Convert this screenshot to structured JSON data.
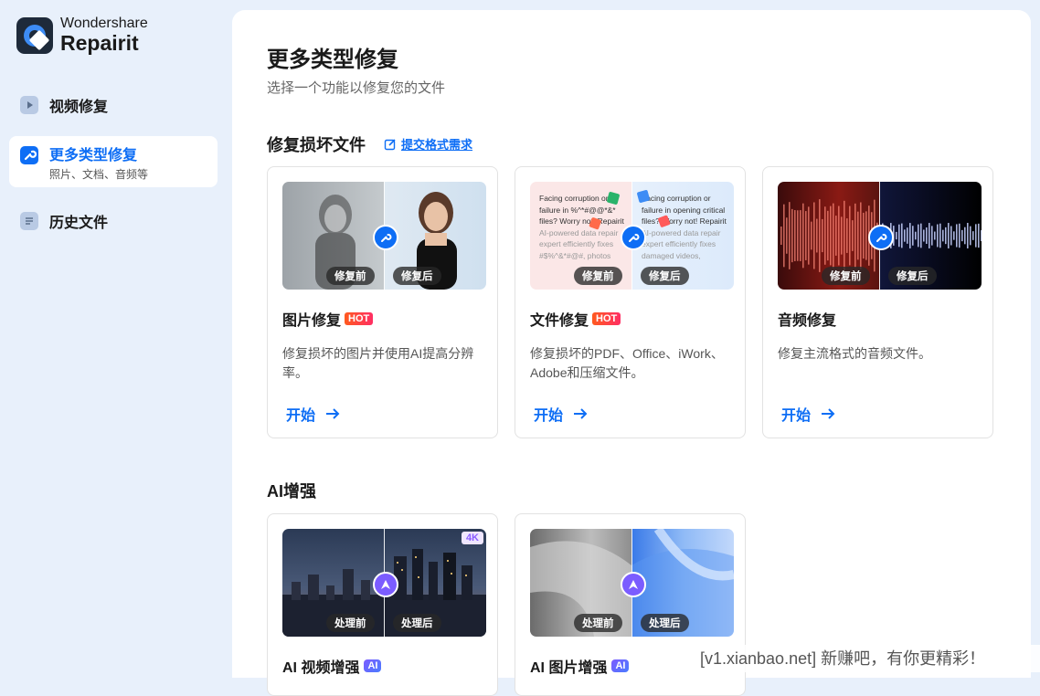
{
  "app": {
    "brand_line1": "Wondershare",
    "brand_line2": "Repairit"
  },
  "sidebar": {
    "items": [
      {
        "label": "视频修复",
        "icon": "play-icon"
      },
      {
        "label": "更多类型修复",
        "sub": "照片、文档、音频等",
        "icon": "wrench-icon"
      },
      {
        "label": "历史文件",
        "icon": "list-icon"
      }
    ]
  },
  "main": {
    "title": "更多类型修复",
    "subtitle": "选择一个功能以修复您的文件",
    "section1": {
      "title": "修复损坏文件",
      "link": "提交格式需求",
      "cards": [
        {
          "title": "图片修复",
          "badge": "HOT",
          "desc": "修复损坏的图片并使用AI提高分辨率。",
          "start": "开始",
          "before": "修复前",
          "after": "修复后"
        },
        {
          "title": "文件修复",
          "badge": "HOT",
          "desc": "修复损坏的PDF、Office、iWork、Adobe和压缩文件。",
          "start": "开始",
          "before": "修复前",
          "after": "修复后",
          "doc_text": [
            "Facing corruption or",
            "failure in %^*#@@*&*",
            "files? Worry not! Repairit",
            "AI-powered data repair",
            "expert efficiently fixes",
            "#$%^&*#@#, photos"
          ],
          "doc_text_right": [
            "Facing corruption or",
            "failure in opening critical",
            "files? Worry not! Repairit",
            "AI-powered data repair",
            "expert efficiently fixes",
            "damaged videos,"
          ]
        },
        {
          "title": "音频修复",
          "badge": "",
          "desc": "修复主流格式的音频文件。",
          "start": "开始",
          "before": "修复前",
          "after": "修复后"
        }
      ]
    },
    "section2": {
      "title": "AI增强",
      "cards": [
        {
          "title": "AI 视频增强",
          "badge": "AI",
          "before": "处理前",
          "after": "处理后",
          "corner": "4K"
        },
        {
          "title": "AI 图片增强",
          "badge": "AI",
          "before": "处理前",
          "after": "处理后"
        }
      ]
    }
  },
  "watermark": "[v1.xianbao.net] 新赚吧，有你更精彩！",
  "colors": {
    "accent": "#0e6ef5",
    "hot": "#ff3a4a",
    "sidebar_bg": "#e8f0fb"
  }
}
